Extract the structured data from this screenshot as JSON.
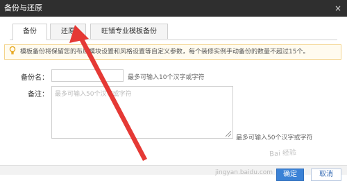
{
  "dialog": {
    "title": "备份与还原",
    "close_glyph": "×"
  },
  "tabs": [
    {
      "label": "备份",
      "active": true
    },
    {
      "label": "还原",
      "active": false
    },
    {
      "label": "旺铺专业模板备份",
      "active": false
    }
  ],
  "notice": {
    "text": "模板备份将保留您的布局模块设置和风格设置等自定义参数，每个装修实例手动备份的数量不超过15个。"
  },
  "form": {
    "name_label": "备份名：",
    "name_value": "",
    "name_hint": "最多可输入10个汉字或字符",
    "note_label": "备注：",
    "note_placeholder": "最多可输入50个汉字或字符",
    "note_hint": "最多可输入50个汉字或字符"
  },
  "buttons": {
    "primary": "确定",
    "secondary": "取消"
  },
  "watermark": {
    "text": "Bai 经验",
    "url": "jingyan.baidu.com"
  },
  "colors": {
    "titlebar": "#2f2f2f",
    "arrow": "#e53935",
    "primary_button": "#3b82d6",
    "notice_border": "#f4d38a"
  }
}
